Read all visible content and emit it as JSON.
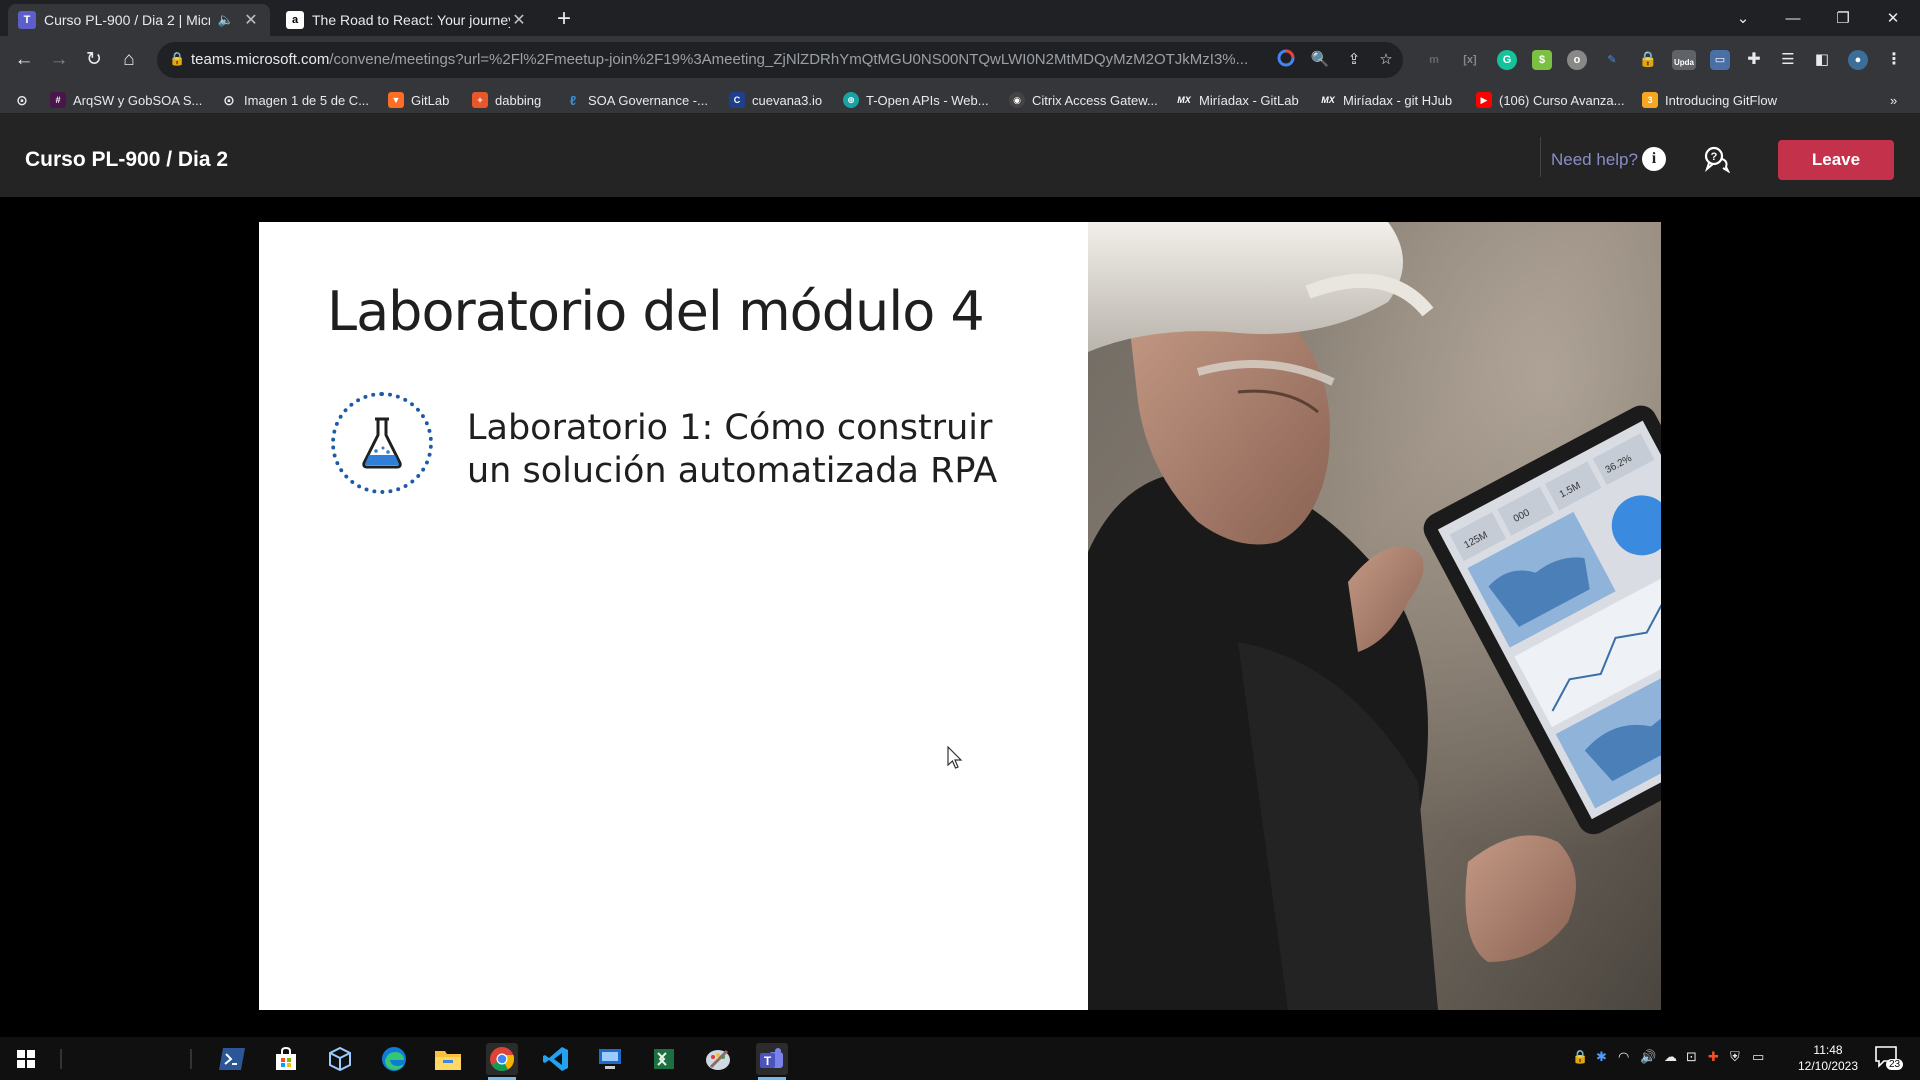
{
  "browser": {
    "tabs": [
      {
        "title": "Curso PL-900 / Dia 2 | Micro",
        "favicon": "teams-icon",
        "audio": true,
        "active": true
      },
      {
        "title": "The Road to React: Your journey",
        "favicon": "amazon-icon",
        "audio": false,
        "active": false
      }
    ],
    "url_host": "teams.microsoft.com",
    "url_path": "/convene/meetings?url=%2Fl%2Fmeetup-join%2F19%3Ameeting_ZjNlZDRhYmQtMGU0NS00NTQwLWI0N2MtMDQyMzM2OTJkMzI3%...",
    "extension_badge": "Upda",
    "bookmarks": [
      "ArqSW y GobSOA S...",
      "Imagen 1 de 5 de C...",
      "GitLab",
      "dabbing",
      "SOA Governance -...",
      "cuevana3.io",
      "T-Open APIs - Web...",
      "Citrix Access Gatew...",
      "Miríadax - GitLab",
      "Miríadax - git HJub",
      "(106) Curso Avanza...",
      "Introducing GitFlow"
    ],
    "bookmark_icon_text": [
      "MX",
      "MX"
    ],
    "more_bookmarks": "»"
  },
  "meeting": {
    "title": "Curso PL-900 / Dia 2",
    "need_help": "Need help?",
    "leave_label": "Leave"
  },
  "slide": {
    "title": "Laboratorio del módulo 4",
    "lab_text": "Laboratorio 1: Cómo construir un solución automatizada RPA",
    "tablet_tiles": [
      "125M",
      "000",
      "1.5M",
      "36.2%"
    ]
  },
  "taskbar": {
    "time": "11:48",
    "date": "12/10/2023",
    "notifications": "23"
  },
  "colors": {
    "leave": "#c4314b",
    "need_help": "#8b8cc7",
    "lab_icon": "#1e5aa8"
  }
}
